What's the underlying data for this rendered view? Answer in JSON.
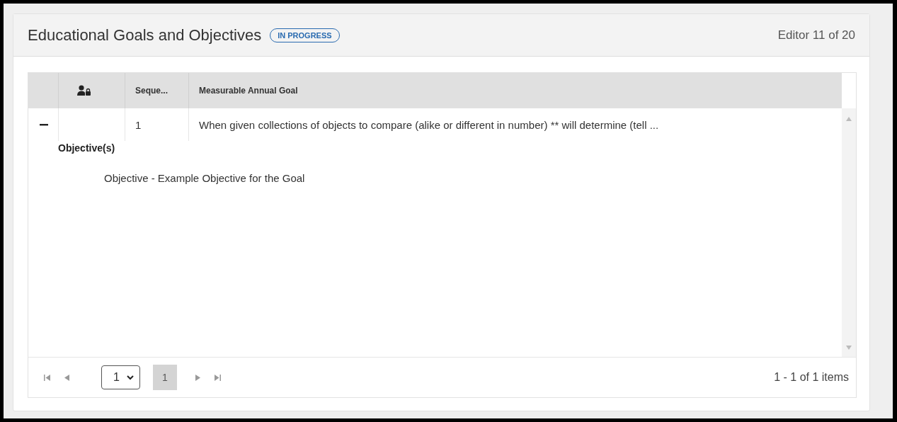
{
  "header": {
    "title": "Educational Goals and Objectives",
    "status": "IN PROGRESS",
    "editor": "Editor 11 of 20"
  },
  "table": {
    "columns": [
      "Seque...",
      "Measurable Annual Goal"
    ],
    "rows": [
      {
        "expanded": true,
        "sequence": "1",
        "goal": "When given collections of objects to compare (alike or different in number) ** will determine (tell ...",
        "detail_heading": "Objective(s)",
        "objectives": [
          "Objective - Example Objective for the Goal"
        ]
      }
    ]
  },
  "pager": {
    "page_select": "1",
    "pages": [
      {
        "label": "1",
        "selected": true
      }
    ],
    "summary": "1 - 1 of 1 items"
  }
}
